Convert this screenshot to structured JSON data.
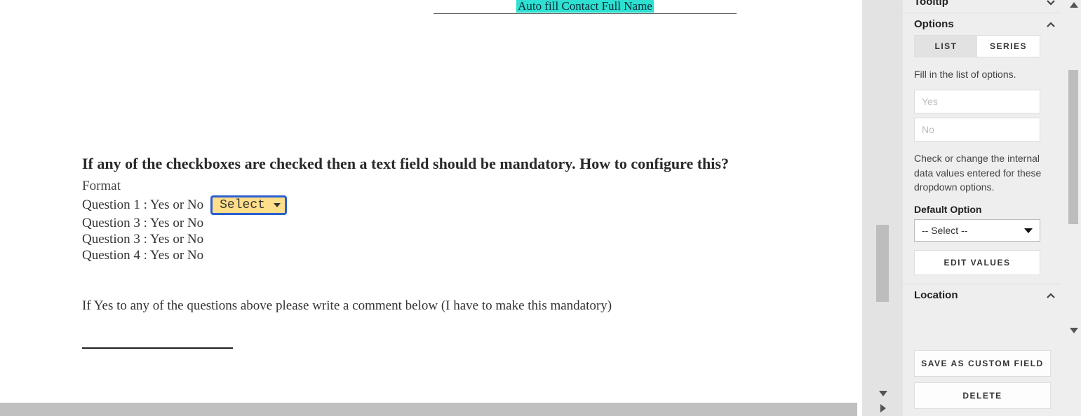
{
  "autofill": "Auto fill Contact Full Name",
  "form": {
    "heading": "If any of the checkboxes are checked then a text field should be mandatory. How to configure this?",
    "format_label": "Format",
    "questions": [
      "Question 1 : Yes or No",
      "Question 3 : Yes or No",
      "Question 3 : Yes or No",
      "Question 4 : Yes or No"
    ],
    "select_label": "Select",
    "prompt": "If Yes to any of the questions above please write a comment below (I have to make this mandatory)"
  },
  "panel": {
    "tooltip_section": "Tooltip",
    "options_section": "Options",
    "tabs": {
      "list": "LIST",
      "series": "SERIES"
    },
    "fill_hint": "Fill in the list of options.",
    "option_placeholder_1": "Yes",
    "option_placeholder_2": "No",
    "values_hint": "Check or change the internal data values entered for these dropdown options.",
    "default_label": "Default Option",
    "default_value": "-- Select --",
    "edit_values": "EDIT VALUES",
    "location_section": "Location",
    "save_custom": "SAVE AS CUSTOM FIELD",
    "delete": "DELETE"
  }
}
